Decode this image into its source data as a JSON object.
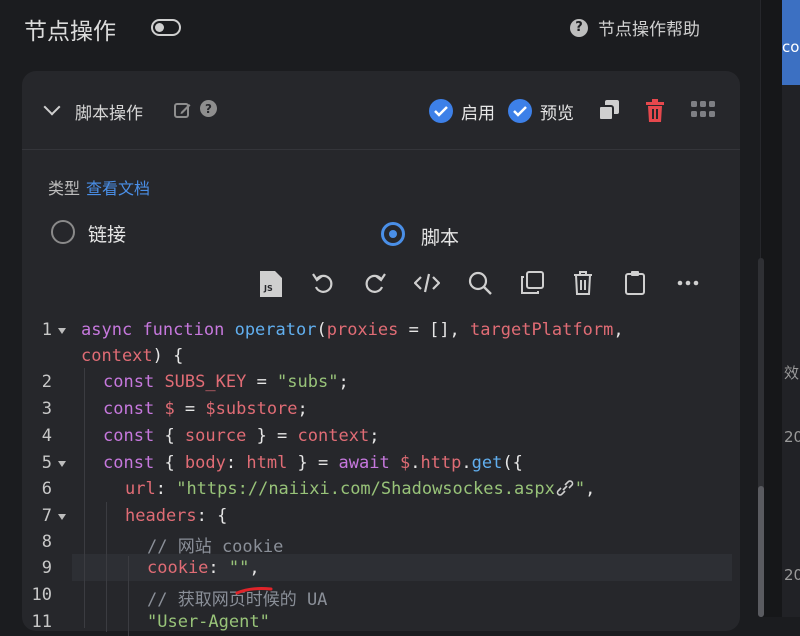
{
  "header": {
    "title": "节点操作",
    "help_label": "节点操作帮助"
  },
  "side_panel": {
    "lines": [
      "co",
      "效",
      "20",
      "20"
    ]
  },
  "card": {
    "title": "脚本操作",
    "enable_label": "启用",
    "preview_label": "预览",
    "type_label": "类型",
    "docs_link": "查看文档",
    "radio_link": "链接",
    "radio_script": "脚本",
    "selected_type": "脚本"
  },
  "editor": {
    "toolbar": [
      "js-format-icon",
      "undo-icon",
      "redo-icon",
      "code-icon",
      "search-icon",
      "copy-icon",
      "delete-icon",
      "clipboard-icon",
      "more-icon"
    ],
    "line_numbers": [
      "1",
      "2",
      "3",
      "4",
      "5",
      "6",
      "7",
      "8",
      "9",
      "10",
      "11"
    ],
    "active_line": 9,
    "lines": {
      "l1a_kw1": "async",
      "l1a_kw2": "function",
      "l1a_fn": "operator",
      "l1a_p1": "(",
      "l1a_v1": "proxies",
      "l1a_p2": " = [], ",
      "l1a_v2": "targetPlatform",
      "l1a_p3": ",",
      "l1b_v": "context",
      "l1b_p": ") {",
      "l2_kw": "const",
      "l2_v": "SUBS_KEY",
      "l2_p": " = ",
      "l2_s": "\"subs\"",
      "l2_e": ";",
      "l3_kw": "const",
      "l3_v": "$",
      "l3_p": " = ",
      "l3_v2": "$substore",
      "l3_e": ";",
      "l4_kw": "const",
      "l4_p1": "{ ",
      "l4_v": "source",
      "l4_p2": " } = ",
      "l4_v2": "context",
      "l4_e": ";",
      "l5_kw": "const",
      "l5_p1": "{ ",
      "l5_v": "body",
      "l5_p2": ": ",
      "l5_v2": "html",
      "l5_p3": " } = ",
      "l5_kw2": "await",
      "l5_v3": "$",
      "l5_p4": ".",
      "l5_v4": "http",
      "l5_p5": ".",
      "l5_fn": "get",
      "l5_p6": "({",
      "l6_v": "url",
      "l6_p": ": ",
      "l6_s": "\"https://naiixi.com/Shadowsockes.aspx",
      "l6_s2": "\"",
      "l6_e": ",",
      "l7_v": "headers",
      "l7_p": ": {",
      "l8_c": "// 网站 cookie",
      "l9_v": "cookie",
      "l9_p": ": ",
      "l9_s": "\"\"",
      "l9_e": ",",
      "l10_c": "// 获取网页时候的 UA",
      "l11_s": "\"User-Agent\""
    }
  }
}
